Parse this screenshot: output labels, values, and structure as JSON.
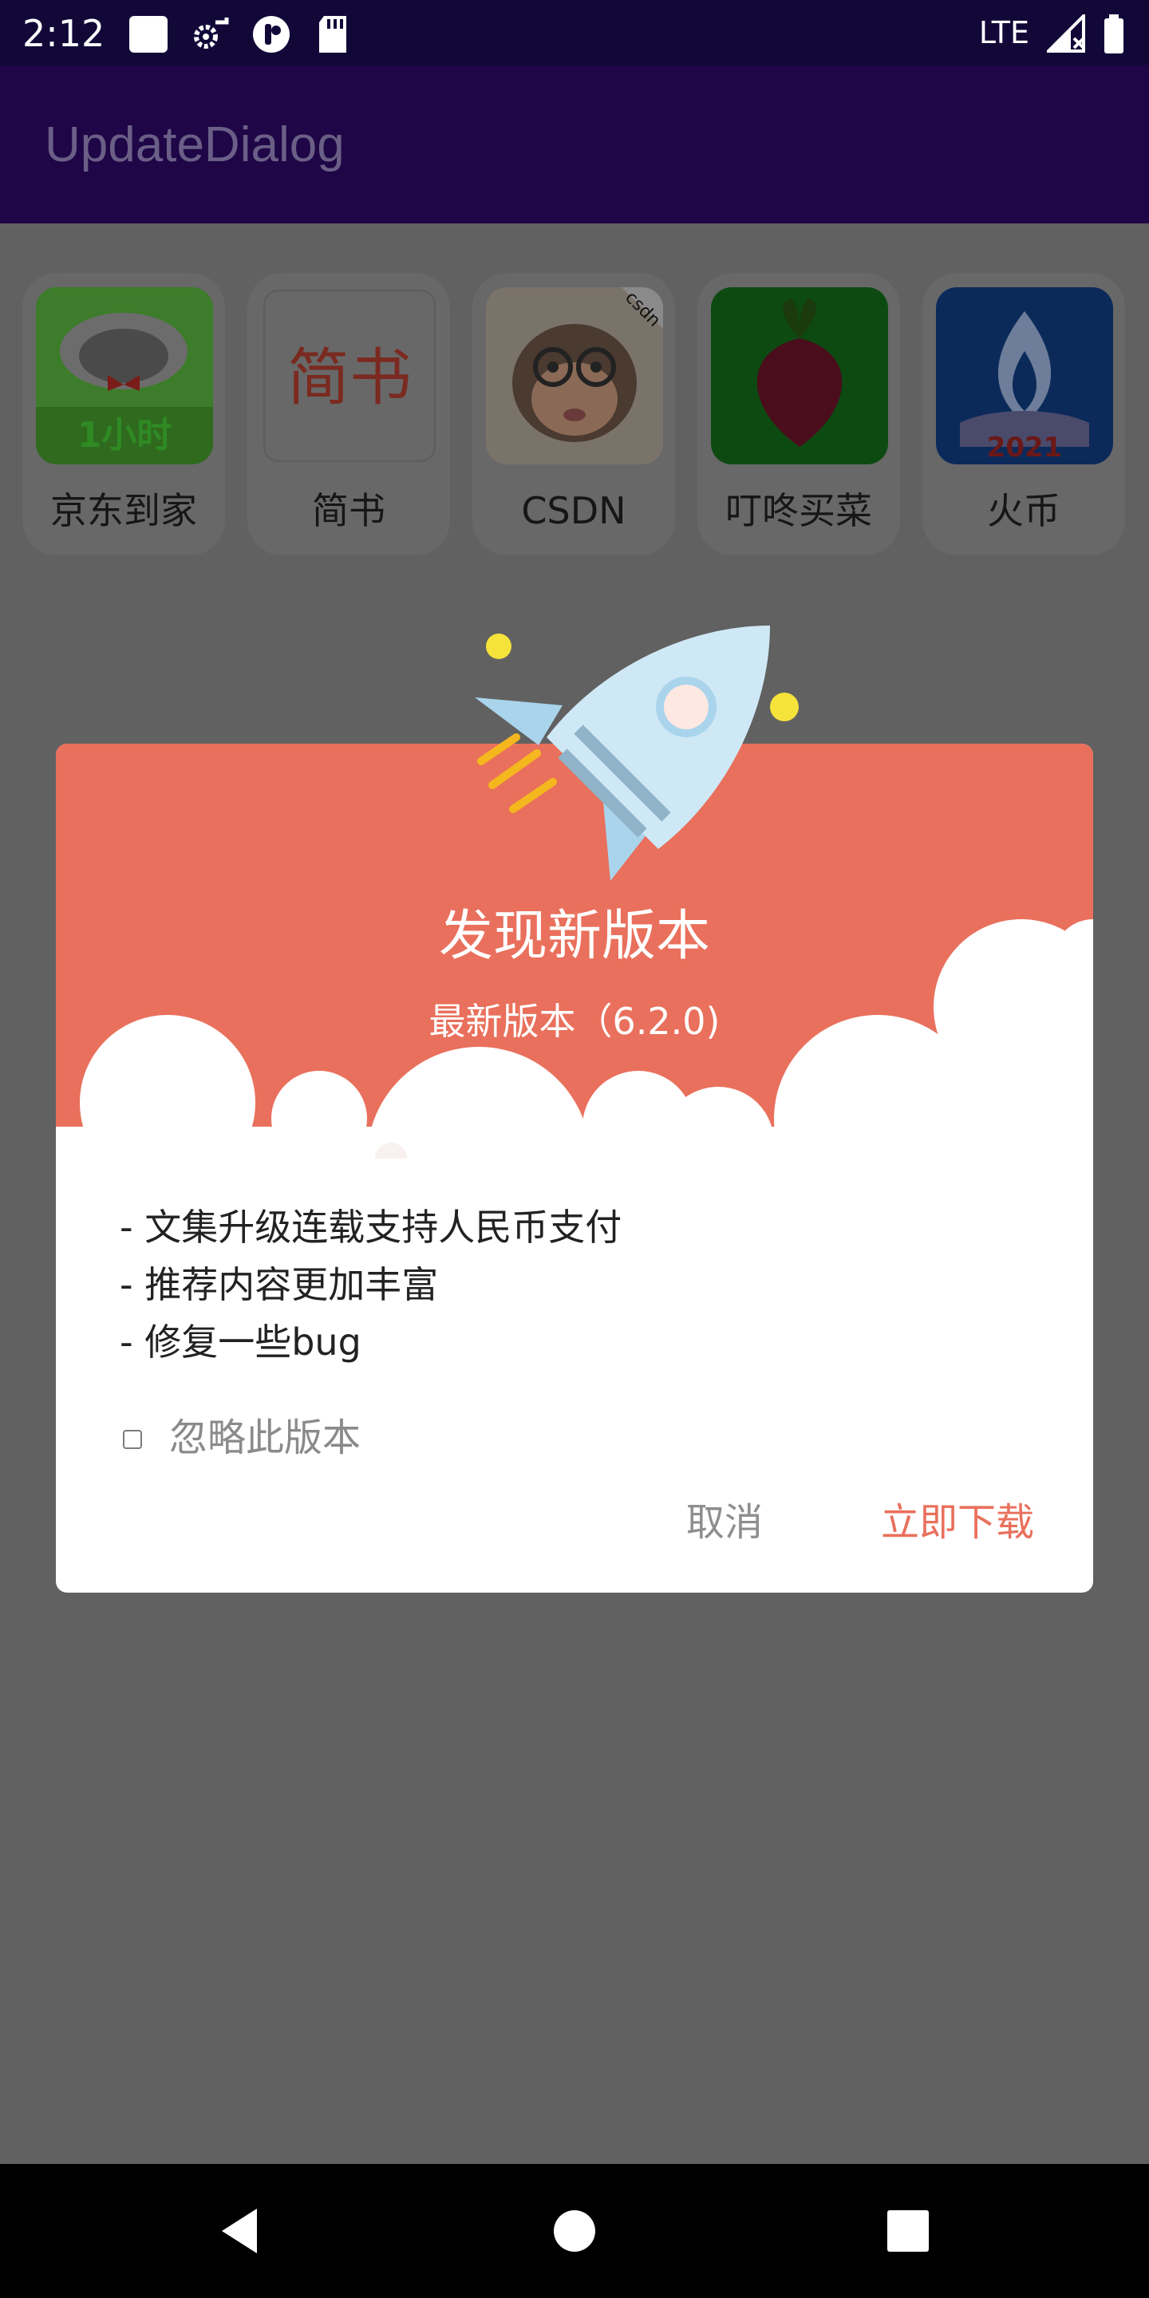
{
  "status_bar": {
    "time": "2:12",
    "network": "LTE"
  },
  "app_bar": {
    "title": "UpdateDialog"
  },
  "apps": [
    {
      "label": "京东到家",
      "badge": "1小时"
    },
    {
      "label": "简书",
      "icon_text": "简书"
    },
    {
      "label": "CSDN",
      "corner_text": "csdn"
    },
    {
      "label": "叮咚买菜"
    },
    {
      "label": "火币",
      "badge": "2021"
    }
  ],
  "dialog": {
    "title": "发现新版本",
    "version": "最新版本（6.2.0)",
    "notes": [
      "- 文集升级连载支持人民币支付",
      "- 推荐内容更加丰富",
      "- 修复一些bug"
    ],
    "ignore_label": "忽略此版本",
    "ignore_checked": false,
    "cancel_label": "取消",
    "download_label": "立即下载",
    "accent_color": "#e9705c"
  },
  "nav_bar": {
    "buttons": [
      "back-icon",
      "home-icon",
      "recents-icon"
    ]
  }
}
